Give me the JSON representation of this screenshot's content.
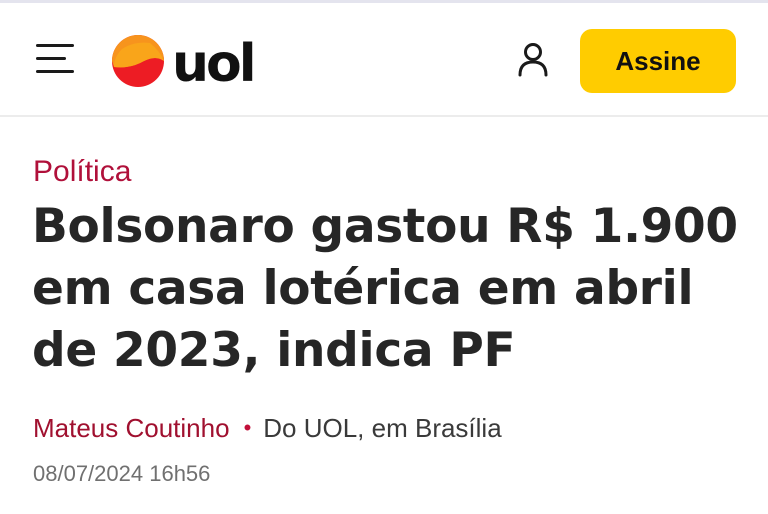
{
  "header": {
    "logo_text": "uol",
    "subscribe_label": "Assine",
    "colors": {
      "subscribe_bg": "#ffcc00",
      "logo_sun_orange": "#f7941d",
      "logo_sun_red": "#ed1c24"
    },
    "icons": {
      "menu": "hamburger-menu-icon",
      "account": "user-icon"
    }
  },
  "article": {
    "section": "Política",
    "headline": "Bolsonaro gastou R$ 1.900 em casa lotérica em abril de 2023, indica PF",
    "author": "Mateus Coutinho",
    "separator": "•",
    "location": "Do UOL, em Brasília",
    "published": "08/07/2024 16h56",
    "colors": {
      "section": "#b0103a",
      "author": "#a0102f"
    }
  }
}
